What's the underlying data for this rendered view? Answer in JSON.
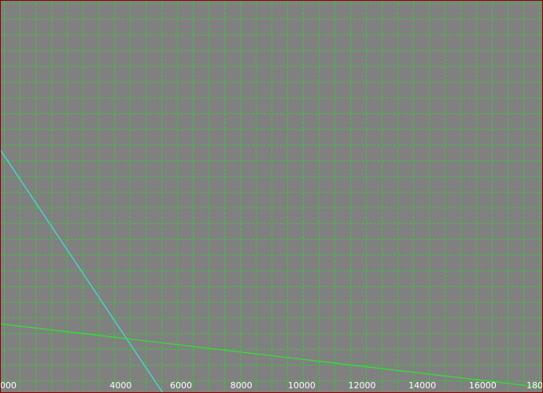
{
  "chart_data": {
    "type": "line",
    "x_ticks": [
      "4000",
      "6000",
      "8000",
      "10000",
      "12000",
      "14000",
      "16000"
    ],
    "x_tick_values": [
      4000,
      6000,
      8000,
      10000,
      12000,
      14000,
      16000
    ],
    "partial_edge_tick_labels": {
      "left": "000",
      "right": "180"
    },
    "xlim": [
      0,
      18000
    ],
    "ylim": [
      0,
      25
    ],
    "grid": true,
    "grid_style": "dashed",
    "series": [
      {
        "color": "#3fe0e0",
        "x": [
          0,
          5400
        ],
        "y": [
          15.5,
          0
        ]
      },
      {
        "color": "#2ee62e",
        "x": [
          0,
          18000
        ],
        "y": [
          4.4,
          0.35
        ]
      }
    ]
  },
  "colors": {
    "background": "#808080",
    "grid": "#22dd22",
    "border": "#8b0000",
    "tick_label": "#ffffff"
  }
}
